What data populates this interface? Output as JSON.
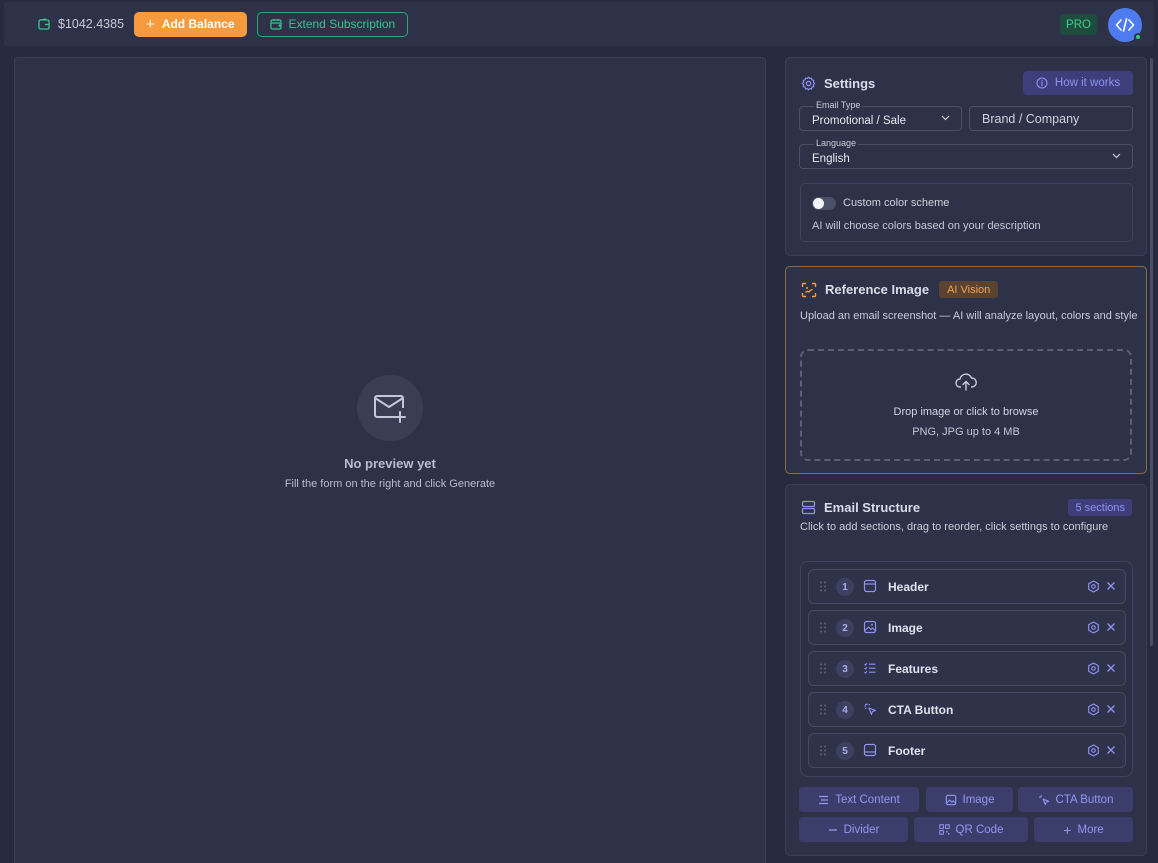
{
  "topbar": {
    "balance": "$1042.4385",
    "add_balance_label": "Add Balance",
    "extend_label": "Extend Subscription",
    "pro_label": "PRO"
  },
  "preview": {
    "title": "No preview yet",
    "subtitle": "Fill the form on the right and click Generate"
  },
  "settings": {
    "title": "Settings",
    "how_label": "How it works",
    "email_type": {
      "label": "Email Type",
      "value": "Promotional / Sale"
    },
    "brand": {
      "placeholder": "Brand / Company"
    },
    "language": {
      "label": "Language",
      "value": "English"
    },
    "color_scheme": {
      "label": "Custom color scheme",
      "description": "AI will choose colors based on your description",
      "enabled": false
    }
  },
  "reference": {
    "title": "Reference Image",
    "badge": "AI Vision",
    "description": "Upload an email screenshot — AI will analyze layout, colors and style",
    "drop_main": "Drop image or click to browse",
    "drop_sub": "PNG, JPG up to 4 MB"
  },
  "structure": {
    "title": "Email Structure",
    "badge": "5 sections",
    "description": "Click to add sections, drag to reorder, click settings to configure",
    "sections": [
      {
        "num": "1",
        "label": "Header",
        "icon": "layout-header-icon"
      },
      {
        "num": "2",
        "label": "Image",
        "icon": "image-icon"
      },
      {
        "num": "3",
        "label": "Features",
        "icon": "list-check-icon"
      },
      {
        "num": "4",
        "label": "CTA Button",
        "icon": "cursor-click-icon"
      },
      {
        "num": "5",
        "label": "Footer",
        "icon": "layout-footer-icon"
      }
    ],
    "add_buttons": {
      "text": "Text Content",
      "image": "Image",
      "cta": "CTA Button",
      "divider": "Divider",
      "qr": "QR Code",
      "more": "More"
    }
  },
  "colors": {
    "accent_orange": "#f59b3d",
    "accent_green": "#35c58b",
    "accent_purple": "#8f92f3",
    "background": "#272b3f",
    "panel": "#2e3248"
  }
}
